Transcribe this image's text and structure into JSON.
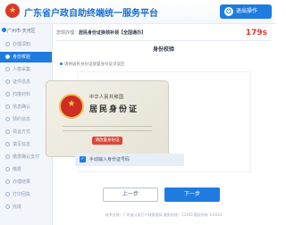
{
  "header": {
    "title": "广东省户政自助终端统一服务平台",
    "exit_label": "退出操作"
  },
  "sidebar": {
    "location": "广州市·天河区",
    "items": [
      {
        "label": "办理须知",
        "active": false
      },
      {
        "label": "身份校验",
        "active": true
      },
      {
        "label": "人像采集",
        "active": false
      },
      {
        "label": "证件信息",
        "active": false
      },
      {
        "label": "扫描材料",
        "active": false
      },
      {
        "label": "信息确认",
        "active": false
      },
      {
        "label": "预约信息",
        "active": false
      },
      {
        "label": "领证方式",
        "active": false
      },
      {
        "label": "填写信息",
        "active": false
      },
      {
        "label": "缴费确认支付",
        "active": false
      },
      {
        "label": "缴费",
        "active": false
      },
      {
        "label": "办理结果",
        "active": false
      },
      {
        "label": "打印回执",
        "active": false
      },
      {
        "label": "完成",
        "active": false
      }
    ]
  },
  "main": {
    "breadcrumb_prefix": "您现办理：",
    "breadcrumb_name": "居民身份证换领补领【全国通办】",
    "timer": "179s",
    "section_title": "身份校验",
    "instruction": "请将居民身份证放置身份证识读区",
    "card": {
      "country": "中华人民共和国",
      "title": "居民身份证",
      "stamp": "请放置身份证"
    },
    "manual_input_label": "手动输入身份证号码",
    "prev_label": "上一步",
    "next_label": "下一步"
  },
  "footer": {
    "text": "技术支持：广东省公安厅户政管理局  服务热线：12345  版权所有 ©2022"
  },
  "colors": {
    "accent": "#1f7be0",
    "timer": "#e23a2b",
    "emblem": "#d02c24"
  },
  "icons": [
    "logo-emblem-icon",
    "exit-icon",
    "location-pin-icon",
    "step-dot-icon",
    "national-emblem-icon",
    "checkbox-icon"
  ]
}
